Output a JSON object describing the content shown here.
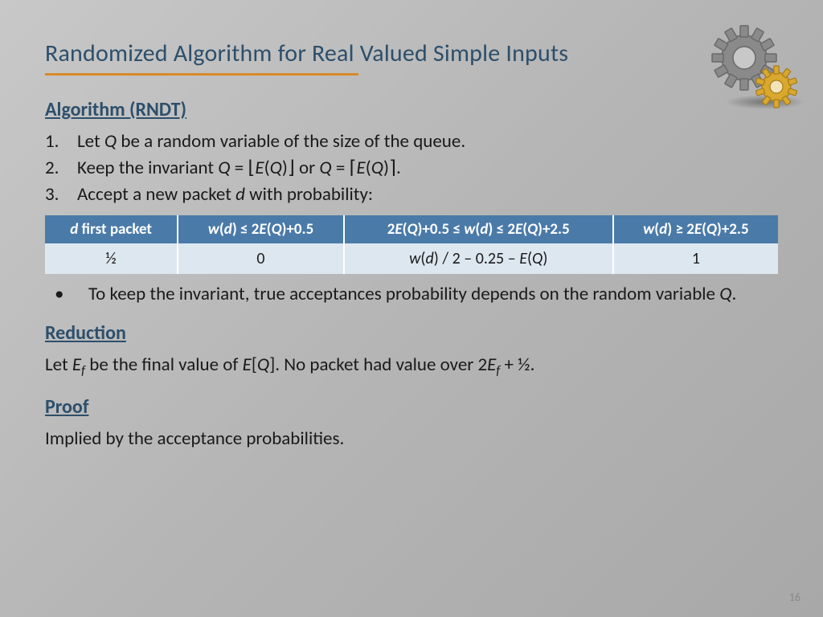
{
  "title": "Randomized Algorithm for Real Valued Simple Inputs",
  "headings": {
    "algorithm": "Algorithm (RNDT)",
    "reduction": "Reduction",
    "proof": "Proof"
  },
  "steps": {
    "s1_num": "1.",
    "s1": "Let Q be a random variable of the size of the queue.",
    "s2_num": "2.",
    "s2": "Keep the invariant Q = ⌊E(Q)⌋ or Q = ⌈E(Q)⌉.",
    "s3_num": "3.",
    "s3": "Accept a new packet d with probability:"
  },
  "table": {
    "headers": {
      "c1": "d first packet",
      "c2": "w(d) ≤ 2E(Q)+0.5",
      "c3": "2E(Q)+0.5 ≤ w(d) ≤ 2E(Q)+2.5",
      "c4": "w(d) ≥ 2E(Q)+2.5"
    },
    "row": {
      "c1": "½",
      "c2": "0",
      "c3": "w(d) / 2 – 0.25 – E(Q)",
      "c4": "1"
    }
  },
  "bullet": "To keep the invariant, true acceptances probability depends on the random variable Q.",
  "reduction_text": "Let Ef be the final value of E[Q]. No packet had value over 2Ef + ½.",
  "proof_text": "Implied by the acceptance probabilities.",
  "page_number": "16"
}
